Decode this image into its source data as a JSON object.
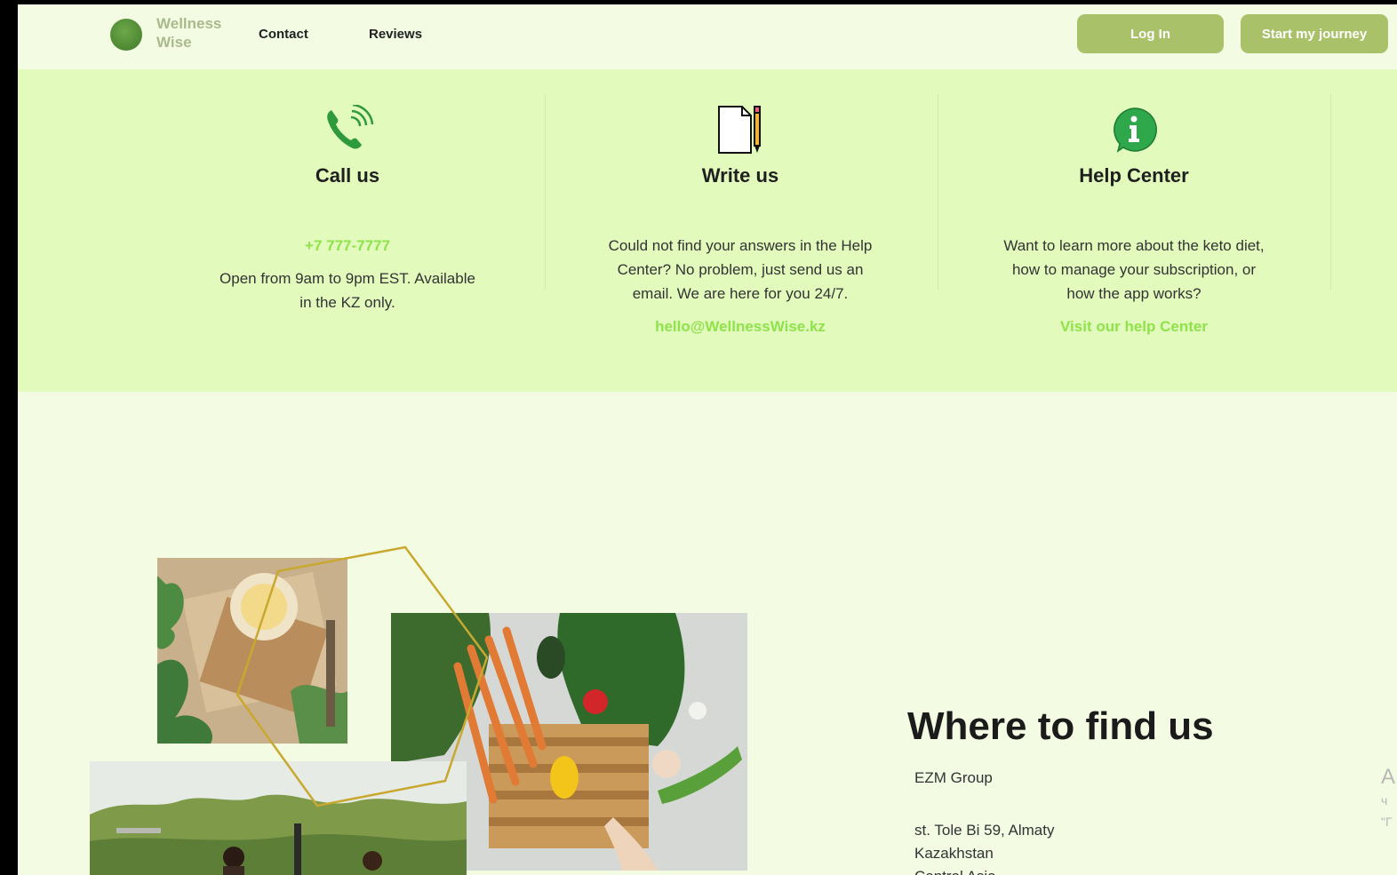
{
  "brand": {
    "name_line1": "Wellness",
    "name_line2": "Wise"
  },
  "nav": {
    "contact": "Contact",
    "reviews": "Reviews"
  },
  "actions": {
    "login": "Log In",
    "start": "Start my journey"
  },
  "contact_cards": [
    {
      "icon": "phone-icon",
      "title": "Call us",
      "link": "+7 777-7777",
      "text_lines": [
        "Open from 9am to 9pm EST. Available",
        "in the KZ only."
      ]
    },
    {
      "icon": "document-pencil-icon",
      "title": "Write us",
      "text_lines": [
        "Could not find your answers in the Help",
        "Center? No problem, just send us an",
        "email. We are here for you 24/7."
      ],
      "link": "hello@WellnessWise.kz"
    },
    {
      "icon": "info-icon",
      "title": "Help Center",
      "text_lines": [
        "Want to learn more about the keto diet,",
        "how to manage your subscription, or",
        "how the app works?"
      ],
      "link": "Visit our help Center"
    }
  ],
  "location": {
    "title": "Where to find us",
    "company": "EZM Group",
    "address_lines": [
      "st. Tole Bi 59, Almaty",
      "Kazakhstan",
      "Central Asia"
    ]
  },
  "edge_fragments": [
    "А",
    "ч",
    "\"Г"
  ],
  "colors": {
    "page_bg": "#f3fbe3",
    "band_bg": "#e2fbbd",
    "button": "#a9c26a",
    "link_green": "#8ee24a",
    "logo_green": "#4f8a34"
  }
}
